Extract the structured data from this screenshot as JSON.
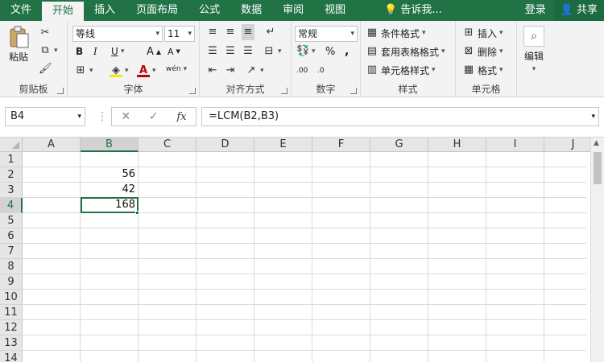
{
  "tabs": [
    "文件",
    "开始",
    "插入",
    "页面布局",
    "公式",
    "数据",
    "审阅",
    "视图"
  ],
  "active_tab": "开始",
  "tell_me": "告诉我...",
  "login": "登录",
  "share": "共享",
  "clipboard": {
    "paste": "粘贴",
    "group_label": "剪贴板"
  },
  "font": {
    "name": "等线",
    "size": "11",
    "bold": "B",
    "italic": "I",
    "underline": "U",
    "grow": "A",
    "shrink": "A",
    "font_color": "A",
    "wen": "wén",
    "group_label": "字体"
  },
  "alignment": {
    "group_label": "对齐方式"
  },
  "number": {
    "format": "常规",
    "percent": "%",
    "comma": ",",
    "inc_decimal": ".00",
    "dec_decimal": ".0",
    "group_label": "数字"
  },
  "styles": {
    "conditional": "条件格式",
    "table": "套用表格格式",
    "cell_styles": "单元格样式",
    "group_label": "样式"
  },
  "cells": {
    "insert": "插入",
    "delete": "删除",
    "format": "格式",
    "group_label": "单元格"
  },
  "editing": {
    "label": "编辑"
  },
  "formula_bar": {
    "name_box": "B4",
    "formula": "=LCM(B2,B3)"
  },
  "sheet": {
    "columns": [
      "A",
      "B",
      "C",
      "D",
      "E",
      "F",
      "G",
      "H",
      "I",
      "J"
    ],
    "rows": [
      "1",
      "2",
      "3",
      "4",
      "5",
      "6",
      "7",
      "8",
      "9",
      "10",
      "11",
      "12",
      "13",
      "14"
    ],
    "values": {
      "B2": "56",
      "B3": "42",
      "B4": "168"
    },
    "selected_col": "B",
    "selected_row": "4"
  },
  "colors": {
    "accent": "#217346"
  }
}
